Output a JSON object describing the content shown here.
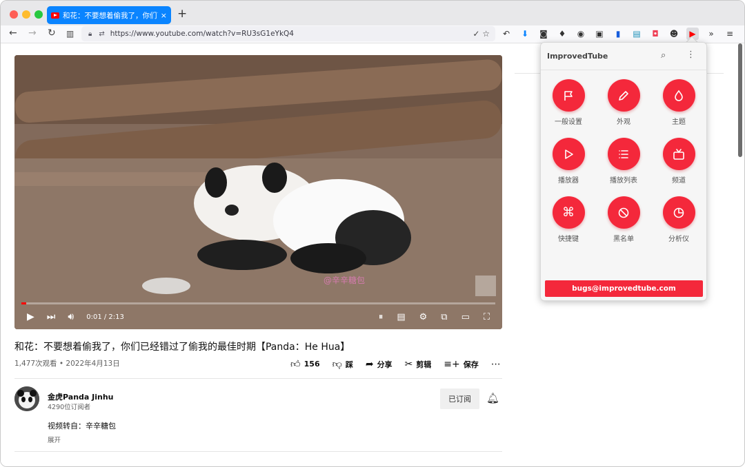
{
  "browser": {
    "tab_title": "和花：不要想着偷我了，你们已经错过了偷我的最佳时期",
    "tab_close": "×",
    "new_tab": "+",
    "url": "https://www.youtube.com/watch?v=RU3sG1eYkQ4"
  },
  "video": {
    "time": "0:01 / 2:13",
    "progress_percent": 1,
    "watermark": "@辛辛糖包"
  },
  "info": {
    "title": "和花：不要想着偷我了，你们已经错过了偷我的最佳时期【Panda：He Hua】",
    "meta": "1,477次观看 • 2022年4月13日",
    "like_count": "156",
    "dislike_label": "踩",
    "share_label": "分享",
    "clip_label": "剪辑",
    "save_label": "保存"
  },
  "channel": {
    "name": "金虎Panda Jinhu",
    "subscribers": "4290位订阅者",
    "description": "视频转自：辛辛糖包",
    "expand": "展开",
    "subscribed_label": "已订阅"
  },
  "popup": {
    "title": "ImprovedTube",
    "items": [
      {
        "label": "一般设置",
        "icon": "flag-icon"
      },
      {
        "label": "外观",
        "icon": "pencil-icon"
      },
      {
        "label": "主题",
        "icon": "droplet-icon"
      },
      {
        "label": "播放器",
        "icon": "play-icon"
      },
      {
        "label": "播放列表",
        "icon": "list-icon"
      },
      {
        "label": "频道",
        "icon": "tv-icon"
      },
      {
        "label": "快捷键",
        "icon": "command-icon"
      },
      {
        "label": "黑名单",
        "icon": "block-icon"
      },
      {
        "label": "分析仪",
        "icon": "pie-chart-icon"
      }
    ],
    "bugs_label": "bugs@improvedtube.com",
    "accent_color": "#f4283b"
  }
}
